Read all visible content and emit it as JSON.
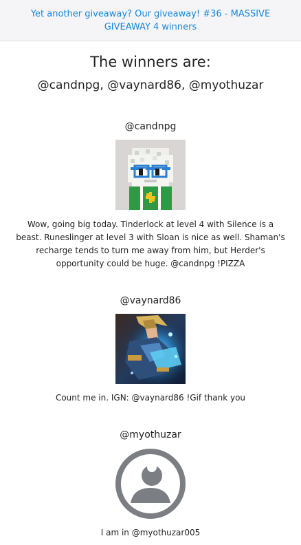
{
  "header": {
    "title": "Yet another giveaway? Our giveaway! #36 - MASSIVE GIVEAWAY 4 winners"
  },
  "headline": {
    "title": "The winners are:",
    "winners_list": "@candnpg, @vaynard86, @myothuzar"
  },
  "winners": [
    {
      "username": "@candnpg",
      "avatar": "pixel-art-avatar",
      "comment": "Wow, going big today. Tinderlock at level 4 with Silence is a beast. Runeslinger at level 3 with Sloan is nice as well. Shaman's recharge tends to turn me away from him, but Herder's opportunity could be huge. @candnpg !PIZZA"
    },
    {
      "username": "@vaynard86",
      "avatar": "game-character-avatar",
      "comment": "Count me in. IGN: @vaynard86 !Gif thank you"
    },
    {
      "username": "@myothuzar",
      "avatar": "default-user-icon",
      "comment": "I am in @myothuzar005"
    }
  ],
  "colors": {
    "link": "#1a86d9",
    "header_bg": "#f5f5f7",
    "default_avatar": "#7b7e83"
  }
}
